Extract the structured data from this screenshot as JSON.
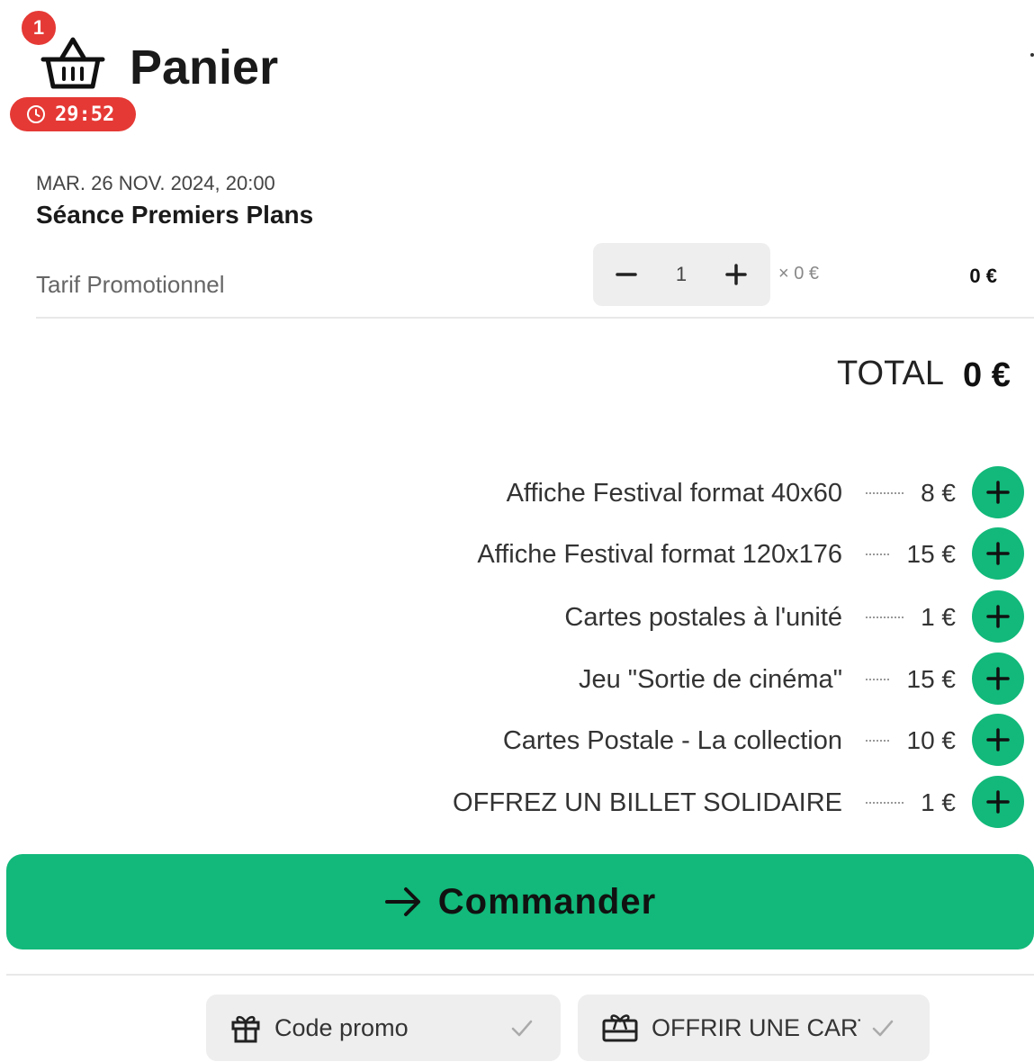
{
  "header": {
    "cart_count": "1",
    "title": "Panier",
    "timer": "29:52"
  },
  "event": {
    "date": "MAR. 26 NOV. 2024, 20:00",
    "title": "Séance Premiers Plans"
  },
  "ticket_line": {
    "tariff": "Tarif Promotionnel",
    "quantity": "1",
    "unit_price": "× 0 €",
    "line_total": "0 €"
  },
  "total": {
    "label": "TOTAL",
    "value": "0 €"
  },
  "extras": [
    {
      "label": "Affiche Festival format 40x60",
      "price": "8 €"
    },
    {
      "label": "Affiche Festival format 120x176",
      "price": "15 €"
    },
    {
      "label": "Cartes postales à l'unité",
      "price": "1 €"
    },
    {
      "label": "Jeu \"Sortie de cinéma\"",
      "price": "15 €"
    },
    {
      "label": "Cartes Postale - La collection",
      "price": "10 €"
    },
    {
      "label": "OFFREZ UN BILLET SOLIDAIRE",
      "price": "1 €"
    }
  ],
  "order_button": {
    "label": "Commander"
  },
  "actions": {
    "promo_label": "Code promo",
    "gift_label": "OFFRIR UNE CARTE"
  },
  "colors": {
    "accent_green": "#12b97a",
    "alert_red": "#e53935"
  },
  "icons": {
    "cart": "basket-icon",
    "timer": "clock-icon",
    "promo": "gift-icon",
    "gift_card": "gift-card-icon",
    "add": "plus-icon",
    "confirm": "check-icon",
    "order": "arrow-right-icon"
  }
}
